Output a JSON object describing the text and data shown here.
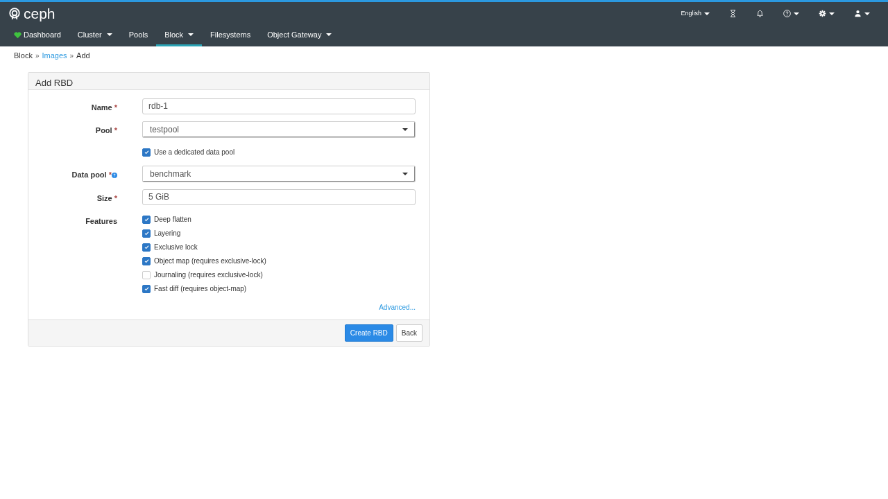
{
  "brand": "ceph",
  "language": {
    "label": "English"
  },
  "toolbar_icons": [
    {
      "kind": "hourglass",
      "dropdown": false
    },
    {
      "kind": "bell",
      "dropdown": false
    },
    {
      "kind": "help",
      "dropdown": true
    },
    {
      "kind": "gear",
      "dropdown": true
    },
    {
      "kind": "user",
      "dropdown": true
    }
  ],
  "nav": [
    {
      "label": "Dashboard",
      "dropdown": false,
      "selected": false
    },
    {
      "label": "Cluster",
      "dropdown": true,
      "selected": false
    },
    {
      "label": "Pools",
      "dropdown": false,
      "selected": false
    },
    {
      "label": "Block",
      "dropdown": true,
      "selected": true
    },
    {
      "label": "Filesystems",
      "dropdown": false,
      "selected": false
    },
    {
      "label": "Object Gateway",
      "dropdown": true,
      "selected": false
    }
  ],
  "breadcrumb": [
    {
      "label": "Block",
      "link": false
    },
    {
      "separator": "»",
      "label": "Images",
      "link": true
    },
    {
      "separator": "»",
      "label": "Add",
      "link": false
    }
  ],
  "form": {
    "title": "Add RBD",
    "fields": [
      {
        "kind": "text",
        "label": "Name",
        "required_mark": "*",
        "value": "rdb-1"
      },
      {
        "kind": "select",
        "label": "Pool",
        "required_mark": "*",
        "value": "testpool"
      },
      {
        "kind": "checkbox",
        "label": "Use a dedicated data pool",
        "checked": true
      },
      {
        "kind": "select",
        "label": "Data pool",
        "required_mark": "*",
        "help": true,
        "value": "benchmark"
      },
      {
        "kind": "text",
        "label": "Size",
        "required_mark": "*",
        "value": "5 GiB"
      },
      {
        "kind": "checklist",
        "label": "Features",
        "options": [
          {
            "label": "Deep flatten",
            "checked": true
          },
          {
            "label": "Layering",
            "checked": true
          },
          {
            "label": "Exclusive lock",
            "checked": true
          },
          {
            "label": "Object map (requires exclusive-lock)",
            "checked": true
          },
          {
            "label": "Journaling (requires exclusive-lock)",
            "checked": false
          },
          {
            "label": "Fast diff (requires object-map)",
            "checked": true
          }
        ]
      }
    ],
    "advanced_link": "Advanced...",
    "buttons": [
      {
        "label": "Create RBD",
        "kind": "primary"
      },
      {
        "label": "Back",
        "kind": "default"
      }
    ]
  }
}
